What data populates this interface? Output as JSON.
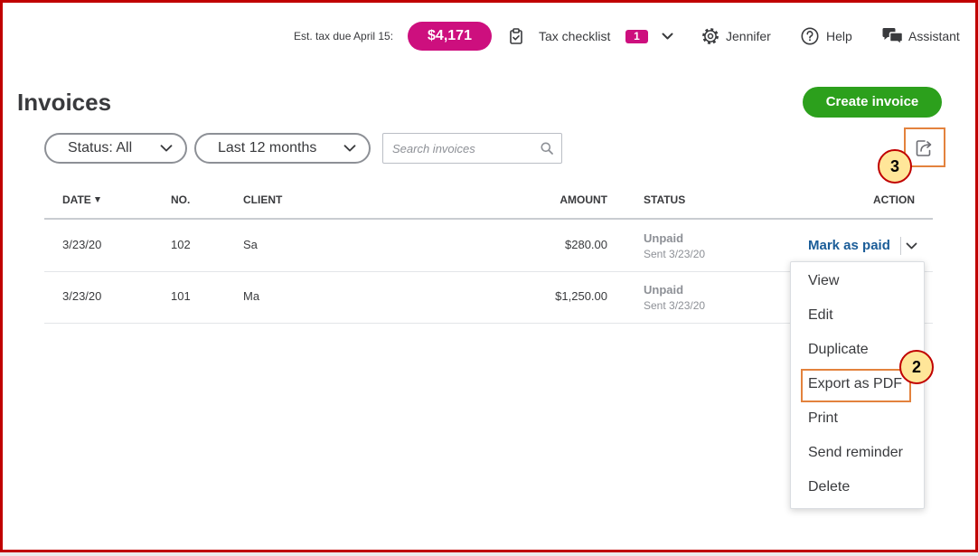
{
  "header": {
    "est_tax_label": "Est. tax due April 15:",
    "est_tax_amount": "$4,171",
    "tax_checklist_label": "Tax checklist",
    "tax_checklist_count": "1",
    "user_name": "Jennifer",
    "help_label": "Help",
    "assistant_label": "Assistant"
  },
  "page": {
    "title": "Invoices",
    "create_button_label": "Create invoice"
  },
  "filters": {
    "status_label": "Status: All",
    "date_range_label": "Last 12 months",
    "search_placeholder": "Search invoices"
  },
  "table": {
    "columns": {
      "date": "DATE",
      "no": "NO.",
      "client": "CLIENT",
      "amount": "AMOUNT",
      "status": "STATUS",
      "action": "ACTION"
    },
    "rows": [
      {
        "date": "3/23/20",
        "no": "102",
        "client": "Sa",
        "amount": "$280.00",
        "status": "Unpaid",
        "status_detail": "Sent 3/23/20",
        "action_label": "Mark as paid"
      },
      {
        "date": "3/23/20",
        "no": "101",
        "client": "Ma",
        "amount": "$1,250.00",
        "status": "Unpaid",
        "status_detail": "Sent 3/23/20"
      }
    ]
  },
  "action_menu": {
    "items": [
      "View",
      "Edit",
      "Duplicate",
      "Export as PDF",
      "Print",
      "Send reminder",
      "Delete"
    ]
  },
  "annotations": [
    {
      "label": "3"
    },
    {
      "label": "2"
    }
  ],
  "icons": {
    "tax_checklist": "clipboard-check-icon",
    "tax_checklist_toggle": "chevron-down-icon",
    "settings": "gear-icon",
    "help": "help-circle-icon",
    "assistant": "chat-bubbles-icon",
    "search": "search-icon",
    "export": "export-icon",
    "sort": "sort-descending-icon",
    "dropdown": "chevron-down-icon"
  },
  "colors": {
    "accent_magenta": "#cd0f7e",
    "primary_green": "#2ca01c",
    "link_blue": "#1a5c98",
    "text_primary": "#393a3d",
    "text_muted": "#8d9096",
    "highlight_orange": "#e3823d",
    "annotation_red": "#c00000",
    "annotation_fill": "#ffe699",
    "frame_red": "#c00000"
  }
}
